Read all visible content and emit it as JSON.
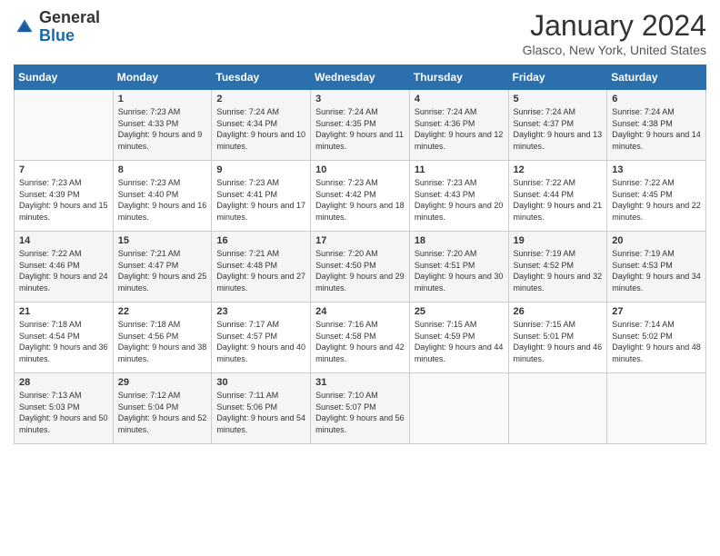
{
  "header": {
    "logo_line1": "General",
    "logo_line2": "Blue",
    "month": "January 2024",
    "location": "Glasco, New York, United States"
  },
  "days_of_week": [
    "Sunday",
    "Monday",
    "Tuesday",
    "Wednesday",
    "Thursday",
    "Friday",
    "Saturday"
  ],
  "weeks": [
    [
      {
        "day": "",
        "sunrise": "",
        "sunset": "",
        "daylight": ""
      },
      {
        "day": "1",
        "sunrise": "Sunrise: 7:23 AM",
        "sunset": "Sunset: 4:33 PM",
        "daylight": "Daylight: 9 hours and 9 minutes."
      },
      {
        "day": "2",
        "sunrise": "Sunrise: 7:24 AM",
        "sunset": "Sunset: 4:34 PM",
        "daylight": "Daylight: 9 hours and 10 minutes."
      },
      {
        "day": "3",
        "sunrise": "Sunrise: 7:24 AM",
        "sunset": "Sunset: 4:35 PM",
        "daylight": "Daylight: 9 hours and 11 minutes."
      },
      {
        "day": "4",
        "sunrise": "Sunrise: 7:24 AM",
        "sunset": "Sunset: 4:36 PM",
        "daylight": "Daylight: 9 hours and 12 minutes."
      },
      {
        "day": "5",
        "sunrise": "Sunrise: 7:24 AM",
        "sunset": "Sunset: 4:37 PM",
        "daylight": "Daylight: 9 hours and 13 minutes."
      },
      {
        "day": "6",
        "sunrise": "Sunrise: 7:24 AM",
        "sunset": "Sunset: 4:38 PM",
        "daylight": "Daylight: 9 hours and 14 minutes."
      }
    ],
    [
      {
        "day": "7",
        "sunrise": "Sunrise: 7:23 AM",
        "sunset": "Sunset: 4:39 PM",
        "daylight": "Daylight: 9 hours and 15 minutes."
      },
      {
        "day": "8",
        "sunrise": "Sunrise: 7:23 AM",
        "sunset": "Sunset: 4:40 PM",
        "daylight": "Daylight: 9 hours and 16 minutes."
      },
      {
        "day": "9",
        "sunrise": "Sunrise: 7:23 AM",
        "sunset": "Sunset: 4:41 PM",
        "daylight": "Daylight: 9 hours and 17 minutes."
      },
      {
        "day": "10",
        "sunrise": "Sunrise: 7:23 AM",
        "sunset": "Sunset: 4:42 PM",
        "daylight": "Daylight: 9 hours and 18 minutes."
      },
      {
        "day": "11",
        "sunrise": "Sunrise: 7:23 AM",
        "sunset": "Sunset: 4:43 PM",
        "daylight": "Daylight: 9 hours and 20 minutes."
      },
      {
        "day": "12",
        "sunrise": "Sunrise: 7:22 AM",
        "sunset": "Sunset: 4:44 PM",
        "daylight": "Daylight: 9 hours and 21 minutes."
      },
      {
        "day": "13",
        "sunrise": "Sunrise: 7:22 AM",
        "sunset": "Sunset: 4:45 PM",
        "daylight": "Daylight: 9 hours and 22 minutes."
      }
    ],
    [
      {
        "day": "14",
        "sunrise": "Sunrise: 7:22 AM",
        "sunset": "Sunset: 4:46 PM",
        "daylight": "Daylight: 9 hours and 24 minutes."
      },
      {
        "day": "15",
        "sunrise": "Sunrise: 7:21 AM",
        "sunset": "Sunset: 4:47 PM",
        "daylight": "Daylight: 9 hours and 25 minutes."
      },
      {
        "day": "16",
        "sunrise": "Sunrise: 7:21 AM",
        "sunset": "Sunset: 4:48 PM",
        "daylight": "Daylight: 9 hours and 27 minutes."
      },
      {
        "day": "17",
        "sunrise": "Sunrise: 7:20 AM",
        "sunset": "Sunset: 4:50 PM",
        "daylight": "Daylight: 9 hours and 29 minutes."
      },
      {
        "day": "18",
        "sunrise": "Sunrise: 7:20 AM",
        "sunset": "Sunset: 4:51 PM",
        "daylight": "Daylight: 9 hours and 30 minutes."
      },
      {
        "day": "19",
        "sunrise": "Sunrise: 7:19 AM",
        "sunset": "Sunset: 4:52 PM",
        "daylight": "Daylight: 9 hours and 32 minutes."
      },
      {
        "day": "20",
        "sunrise": "Sunrise: 7:19 AM",
        "sunset": "Sunset: 4:53 PM",
        "daylight": "Daylight: 9 hours and 34 minutes."
      }
    ],
    [
      {
        "day": "21",
        "sunrise": "Sunrise: 7:18 AM",
        "sunset": "Sunset: 4:54 PM",
        "daylight": "Daylight: 9 hours and 36 minutes."
      },
      {
        "day": "22",
        "sunrise": "Sunrise: 7:18 AM",
        "sunset": "Sunset: 4:56 PM",
        "daylight": "Daylight: 9 hours and 38 minutes."
      },
      {
        "day": "23",
        "sunrise": "Sunrise: 7:17 AM",
        "sunset": "Sunset: 4:57 PM",
        "daylight": "Daylight: 9 hours and 40 minutes."
      },
      {
        "day": "24",
        "sunrise": "Sunrise: 7:16 AM",
        "sunset": "Sunset: 4:58 PM",
        "daylight": "Daylight: 9 hours and 42 minutes."
      },
      {
        "day": "25",
        "sunrise": "Sunrise: 7:15 AM",
        "sunset": "Sunset: 4:59 PM",
        "daylight": "Daylight: 9 hours and 44 minutes."
      },
      {
        "day": "26",
        "sunrise": "Sunrise: 7:15 AM",
        "sunset": "Sunset: 5:01 PM",
        "daylight": "Daylight: 9 hours and 46 minutes."
      },
      {
        "day": "27",
        "sunrise": "Sunrise: 7:14 AM",
        "sunset": "Sunset: 5:02 PM",
        "daylight": "Daylight: 9 hours and 48 minutes."
      }
    ],
    [
      {
        "day": "28",
        "sunrise": "Sunrise: 7:13 AM",
        "sunset": "Sunset: 5:03 PM",
        "daylight": "Daylight: 9 hours and 50 minutes."
      },
      {
        "day": "29",
        "sunrise": "Sunrise: 7:12 AM",
        "sunset": "Sunset: 5:04 PM",
        "daylight": "Daylight: 9 hours and 52 minutes."
      },
      {
        "day": "30",
        "sunrise": "Sunrise: 7:11 AM",
        "sunset": "Sunset: 5:06 PM",
        "daylight": "Daylight: 9 hours and 54 minutes."
      },
      {
        "day": "31",
        "sunrise": "Sunrise: 7:10 AM",
        "sunset": "Sunset: 5:07 PM",
        "daylight": "Daylight: 9 hours and 56 minutes."
      },
      {
        "day": "",
        "sunrise": "",
        "sunset": "",
        "daylight": ""
      },
      {
        "day": "",
        "sunrise": "",
        "sunset": "",
        "daylight": ""
      },
      {
        "day": "",
        "sunrise": "",
        "sunset": "",
        "daylight": ""
      }
    ]
  ]
}
